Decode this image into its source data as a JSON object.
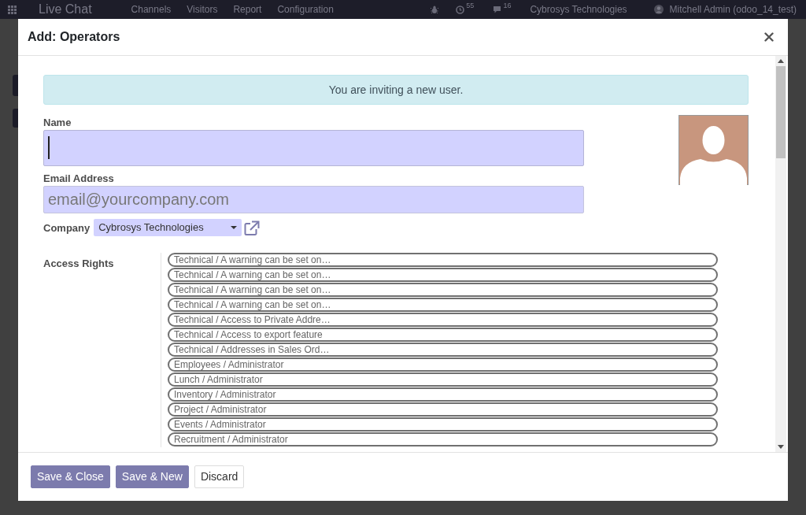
{
  "background_navbar": {
    "app_title": "Live Chat",
    "menus": [
      "Channels",
      "Visitors",
      "Report",
      "Configuration"
    ],
    "counters": [
      {
        "kind": "clock",
        "count": "55"
      },
      {
        "kind": "chat",
        "count": "16"
      }
    ],
    "company": "Cybrosys Technologies",
    "user": "Mitchell Admin (odoo_14_test)"
  },
  "dialog": {
    "title": "Add: Operators"
  },
  "alert": {
    "text": "You are inviting a new user."
  },
  "name_field": {
    "label": "Name",
    "focused": true
  },
  "email_field": {
    "label": "Email Address",
    "placeholder": "email@yourcompany.com"
  },
  "company_field": {
    "label": "Company",
    "value": "Cybrosys Technologies"
  },
  "access_rights": {
    "label": "Access Rights",
    "items": [
      "Technical / A warning can be set on…",
      "Technical / A warning can be set on…",
      "Technical / A warning can be set on…",
      "Technical / A warning can be set on…",
      "Technical / Access to Private Addre…",
      "Technical / Access to export feature",
      "Technical / Addresses in Sales Ord…",
      "Employees / Administrator",
      "Lunch / Administrator",
      "Inventory / Administrator",
      "Project / Administrator",
      "Events / Administrator",
      "Recruitment / Administrator"
    ]
  },
  "footer_buttons": [
    {
      "label": "Save & Close",
      "kind": "primary"
    },
    {
      "label": "Save & New",
      "kind": "primary"
    },
    {
      "label": "Discard",
      "kind": "secondary"
    }
  ]
}
